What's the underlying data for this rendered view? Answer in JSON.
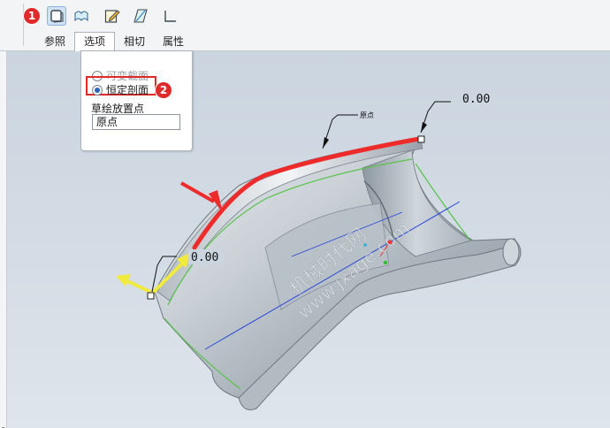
{
  "toolbar": {
    "tools": [
      {
        "name": "surface-icon",
        "active": true
      },
      {
        "name": "sheet-icon",
        "active": false
      },
      {
        "name": "sketch-edit-icon",
        "active": false
      },
      {
        "name": "plane-icon",
        "active": false
      },
      {
        "name": "corner-icon",
        "active": false
      }
    ],
    "tabs": [
      "参照",
      "选项",
      "相切",
      "属性"
    ],
    "selected_tab": "选项"
  },
  "badges": {
    "one": "1",
    "two": "2"
  },
  "options_panel": {
    "radio_variable": "可变截面",
    "radio_constant": "恒定剖面",
    "selected": "恒定剖面",
    "placement_label": "草绘放置点",
    "placement_value": "原点"
  },
  "annotations": {
    "dim_top": "0.00",
    "dim_left": "0.00",
    "origin_label": "原点"
  },
  "watermark": {
    "line1": "机械时代网",
    "line2": "www.jxage.com"
  },
  "colors": {
    "highlight_red": "#e02a2a",
    "trajectory_red": "#ee2b2b",
    "arrow_yellow": "#f0ea3a",
    "axis_blue": "#2846d8",
    "edge_green": "#59c24a",
    "model_gray": "#aab2ba"
  }
}
